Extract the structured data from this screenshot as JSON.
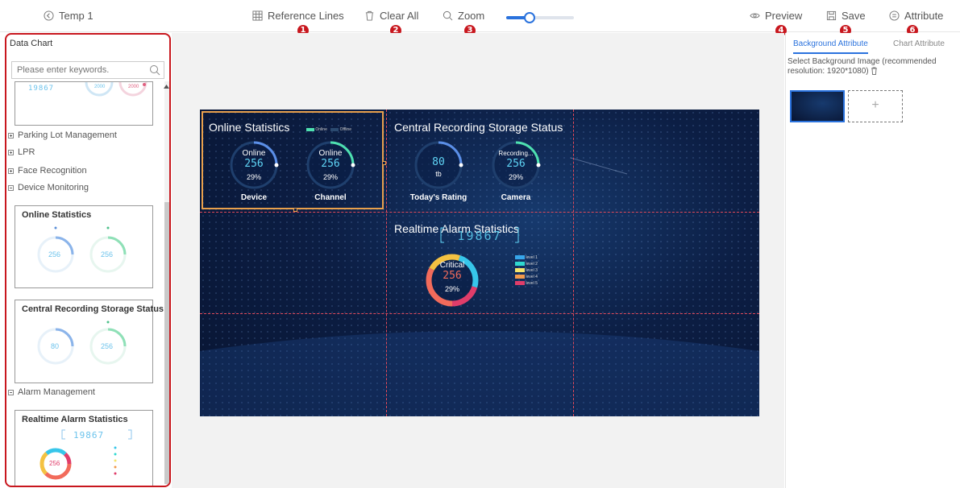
{
  "toolbar": {
    "back_label": "Temp 1",
    "reference_lines": "Reference Lines",
    "clear_all": "Clear All",
    "zoom": "Zoom",
    "zoom_level": 0.35,
    "preview": "Preview",
    "save": "Save",
    "attribute": "Attribute",
    "badges": [
      "1",
      "2",
      "3",
      "4",
      "5",
      "6"
    ]
  },
  "left_panel": {
    "title": "Data Chart",
    "search_placeholder": "Please enter keywords.",
    "top_card": {
      "number": "19867",
      "g1": "2000",
      "g2": "2000"
    },
    "categories": [
      "Parking Lot Management",
      "LPR",
      "Face Recognition",
      "Device Monitoring"
    ],
    "alarm_category": "Alarm Management",
    "cards": [
      {
        "title": "Online Statistics",
        "g1": "256",
        "g2": "256"
      },
      {
        "title": "Central Recording Storage Status",
        "g1": "80",
        "g2": "256"
      },
      {
        "title": "Realtime Alarm Statistics",
        "number": "19867",
        "g1": "256"
      }
    ]
  },
  "canvas": {
    "online": {
      "title": "Online Statistics",
      "legend": [
        "Online",
        "Offline"
      ],
      "gauges": [
        {
          "top": "Online",
          "value": "256",
          "pct": "29%",
          "label": "Device"
        },
        {
          "top": "Online",
          "value": "256",
          "pct": "29%",
          "label": "Channel"
        }
      ]
    },
    "storage": {
      "title": "Central Recording Storage Status",
      "gauges": [
        {
          "top": "",
          "value": "80",
          "pct": "tb",
          "label": "Today's Rating"
        },
        {
          "top": "Recording...",
          "value": "256",
          "pct": "29%",
          "label": "Camera"
        }
      ]
    },
    "alarm": {
      "title": "Realtime Alarm Statistics",
      "number": "19867",
      "donut": {
        "top": "Critical",
        "value": "256",
        "pct": "29%"
      },
      "levels": [
        "level 1",
        "level 2",
        "level 3",
        "level 4",
        "level 5"
      ]
    }
  },
  "right_panel": {
    "tab_bg": "Background Attribute",
    "tab_chart": "Chart Attribute",
    "desc": "Select Background Image (recommended resolution: 1920*1080)",
    "add": "+"
  },
  "colors": {
    "accent": "#2a72dd",
    "badge": "#c8171e",
    "guide": "#e24a5a",
    "selection": "#e8a04c",
    "gauge": "#5fd4f5"
  }
}
